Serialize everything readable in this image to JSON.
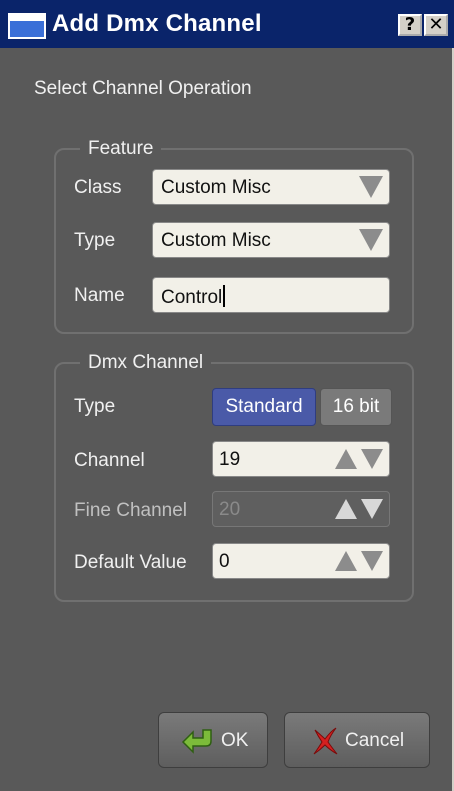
{
  "window": {
    "title": "Add Dmx Channel",
    "help_button": "?",
    "close_button": "✕"
  },
  "instruction": "Select Channel Operation",
  "feature": {
    "group_title": "Feature",
    "class_label": "Class",
    "class_value": "Custom Misc",
    "type_label": "Type",
    "type_value": "Custom Misc",
    "name_label": "Name",
    "name_value": "Control"
  },
  "dmx": {
    "group_title": "Dmx Channel",
    "type_label": "Type",
    "type_options": [
      "Standard",
      "16 bit"
    ],
    "type_selected": "Standard",
    "channel_label": "Channel",
    "channel_value": "19",
    "fine_channel_label": "Fine Channel",
    "fine_channel_value": "20",
    "default_value_label": "Default Value",
    "default_value": "0"
  },
  "buttons": {
    "ok": "OK",
    "cancel": "Cancel"
  },
  "colors": {
    "background": "#595959",
    "selected_segment": "#4a5aa8",
    "titlebar": "#0a246a"
  },
  "icons": {
    "ok": "green-arrow-icon",
    "cancel": "red-x-icon",
    "combo": "chevron-down-icon",
    "spin_up": "arrow-up-icon",
    "spin_down": "arrow-down-icon"
  }
}
